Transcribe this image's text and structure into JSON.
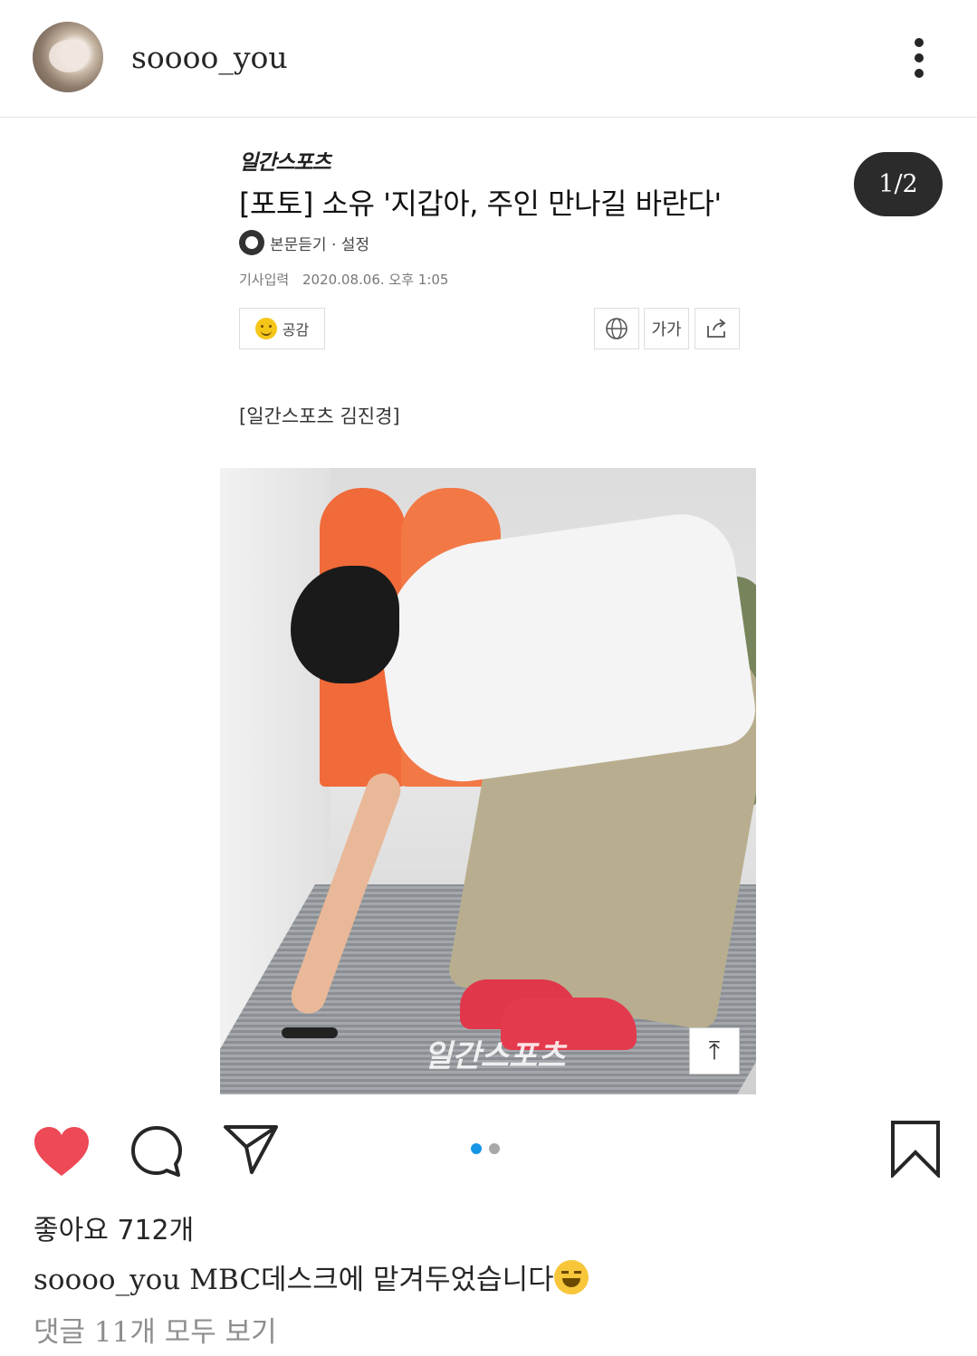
{
  "header": {
    "username": "soooo_you"
  },
  "post": {
    "counter": "1/2",
    "article": {
      "logo": "일간스포츠",
      "headline": "[포토] 소유 '지갑아, 주인 만나길 바란다'",
      "listen": "본문듣기 · 설정",
      "date_label": "기사입력",
      "date_value": "2020.08.06. 오후 1:05",
      "like_button": "공감",
      "font_button": "가가",
      "credit": "[일간스포츠 김진경]"
    },
    "photo": {
      "watermark": "일간스포츠"
    }
  },
  "actions": {
    "page_count": 2,
    "active_page": 1
  },
  "likes": {
    "label": "좋아요",
    "count": "712개"
  },
  "caption": {
    "username": "soooo_you",
    "text": "MBC데스크에 맡겨두었습니다"
  },
  "comments_link": "댓글 11개 모두 보기",
  "colors": {
    "heart": "#ed4956",
    "active_dot": "#1795e6",
    "counter_bg": "#2b2b2b"
  }
}
